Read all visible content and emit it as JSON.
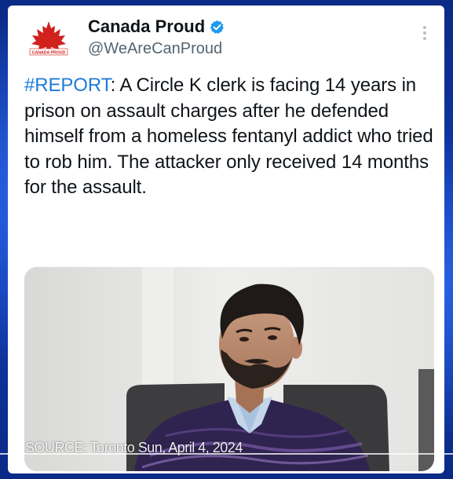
{
  "account": {
    "display_name": "Canada Proud",
    "handle": "@WeAreCanProud",
    "avatar_text": "CANADA PROUD",
    "verified": true,
    "verified_color": "#1d9bf0"
  },
  "tweet": {
    "hashtag": "#REPORT",
    "body": ": A Circle K clerk is facing 14 years in prison on assault charges after he defended himself from a homeless fentanyl addict who tried to rob him. The attacker only received 14 months for the assault.",
    "hashtag_color": "#1d7bd8"
  },
  "media": {
    "caption": "SOURCE: Toronto Sun, April 4, 2024"
  },
  "icons": {
    "more": "more-vertical-icon",
    "verified": "verified-badge-icon",
    "avatar": "maple-leaf-icon"
  }
}
